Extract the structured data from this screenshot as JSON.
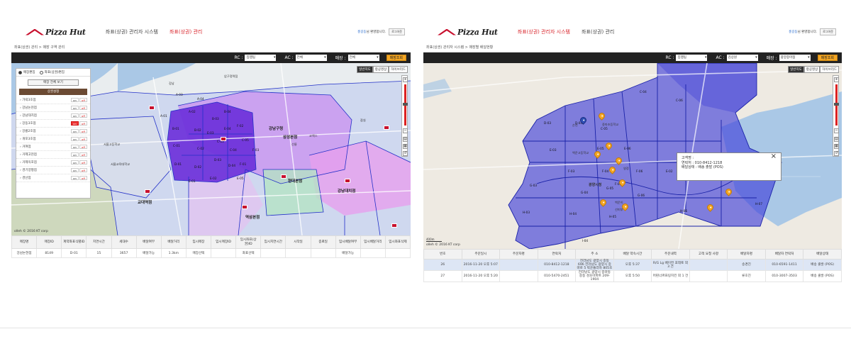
{
  "brand": {
    "logo_text": "Pizza Hut"
  },
  "left": {
    "nav": [
      "좌표(상권) 관리자 시스템",
      "좌표(상권) 관리"
    ],
    "user": {
      "name": "홍길동",
      "greeting": "님 환영합니다.",
      "logout": "로그아웃"
    },
    "breadcrumb": "좌표(상권) 관리 > 매장 구역 관리",
    "filters": {
      "rc_label": "RC :",
      "rc_value": "집행팀",
      "ac_label": "AC :",
      "ac_value": "전체",
      "store_label": "매장 :",
      "store_value": "전체",
      "search_button": "매장조회"
    },
    "map_types": [
      "일반지도",
      "항공영상",
      "하이브리드"
    ],
    "side_panel": {
      "radio_store": "매장편집",
      "radio_coord": "좌표(상권)편집",
      "view_all": "매장 전체 보기",
      "title": "상권설정",
      "on": "on",
      "off": "off",
      "stores": [
        "가락3호점",
        "강남논현점",
        "강남대치점",
        "강동3호점",
        "강릉2호점",
        "개포3호점",
        "거여점",
        "거제고현점",
        "거제옥포점",
        "경기양평점",
        "경산점"
      ]
    },
    "map_labels": [
      "강남구청",
      "삼성본점",
      "현대본점",
      "역삼본점",
      "강남대치점",
      "교대역점",
      "서울교육대학교",
      "서울고등학교",
      "코엑스",
      "선릉",
      "강남",
      "압구정역점",
      "잠실"
    ],
    "cells": [
      "A-03",
      "A-04",
      "A-02",
      "B-01",
      "B-02",
      "B-03",
      "B-04",
      "C-01",
      "C-02",
      "C-03",
      "C-04",
      "C-05",
      "D-01",
      "D-02",
      "D-03",
      "D-04",
      "E-01",
      "E-02",
      "F-01",
      "F-02",
      "F-03",
      "A-01",
      "E-03",
      "E-04",
      "E-05"
    ],
    "copyright": "olleh © 2016 KT corp",
    "table": {
      "headers": [
        "매장명",
        "매장ID",
        "계약좌표식별ID",
        "지연시간",
        "세대수",
        "배달여부",
        "배달거리",
        "임시매장",
        "임시매장ID",
        "임시좌표(상권)ID",
        "임시지연시간",
        "시작일",
        "종료일",
        "임시배달여부",
        "임시배달거리",
        "임시좌표삭제"
      ],
      "row": [
        "강남논현점",
        "8149",
        "D-01",
        "15",
        "3657",
        "배달가능",
        "1.3km",
        "매장선택",
        "",
        "좌표선택",
        "",
        "",
        "",
        "배달가능",
        "",
        ""
      ]
    }
  },
  "right": {
    "nav": [
      "좌표(상권) 관리자 시스템",
      "좌표(상권) 관리"
    ],
    "user": {
      "name": "홍길동",
      "greeting": "님 환영합니다.",
      "logout": "로그아웃"
    },
    "breadcrumb": "좌표(상권) 관리자 시스템 > 매장별 배달현황",
    "filters": {
      "rc_label": "RC :",
      "rc_value": "집행팀",
      "ac_label": "AC :",
      "ac_value": "김상원",
      "store_label": "매장 :",
      "store_value": "광양중마점",
      "search_button": "매장조회"
    },
    "map_types": [
      "일반지도",
      "항공영상",
      "하이브리드"
    ],
    "cells": [
      "C-04",
      "D-04",
      "D-03",
      "C-05",
      "C-06",
      "E-05",
      "E-06",
      "E-03",
      "F-03",
      "F-04",
      "F-05",
      "F-06",
      "G-03",
      "G-04",
      "G-05",
      "G-06",
      "H-03",
      "H-04",
      "H-05",
      "H-06",
      "H-07",
      "I-04",
      "E-02"
    ],
    "popup": {
      "line1": "고객명 :",
      "line2": "연락처 : 010-8412-1218",
      "line3": "배달상태 : 배송 출발 (POS)"
    },
    "map_labels": [
      "광양시청",
      "순천",
      "백운고등학교",
      "중마초등학교",
      "선미부",
      "백운이",
      "영정"
    ],
    "scale": "400m",
    "copyright": "olleh © 2016 KT corp",
    "table": {
      "headers": [
        "번호",
        "주문일시",
        "주문자명",
        "연락처",
        "주 소",
        "배달 약속시간",
        "주문내역",
        "고객 요청 사항",
        "배달자명",
        "배달자 연락처",
        "배달상태"
      ],
      "rows": [
        [
          "26",
          "2016-11-20 오후 5:07",
          "",
          "010-8412-1218",
          "전라남도 광양시 중동 696 전라남도 광양시 중마로 5 박운플라자 805호",
          "오후 5:37",
          "R/G Lg 베이컨 포테토 외 3 건",
          "",
          "송경진",
          "010-6591-1411",
          "배송 출발 (POS)"
        ],
        [
          "27",
          "2016-11-20 오후 5:20",
          "",
          "010-5470-2451",
          "전라남도 광양시 중마동 중동 성호아파트 209-1904",
          "오후 5:50",
          "머핀너르프링치킨 외 1 건",
          "",
          "류호진",
          "010-3007-3503",
          "배송 출발 (POS)"
        ]
      ]
    }
  },
  "colors": {
    "brand_red": "#c8102e",
    "accent_orange": "#f4a623",
    "zone_blue": "#3a3ad8",
    "zone_purple": "#9d4fe0",
    "zone_violet": "#c990f0"
  }
}
